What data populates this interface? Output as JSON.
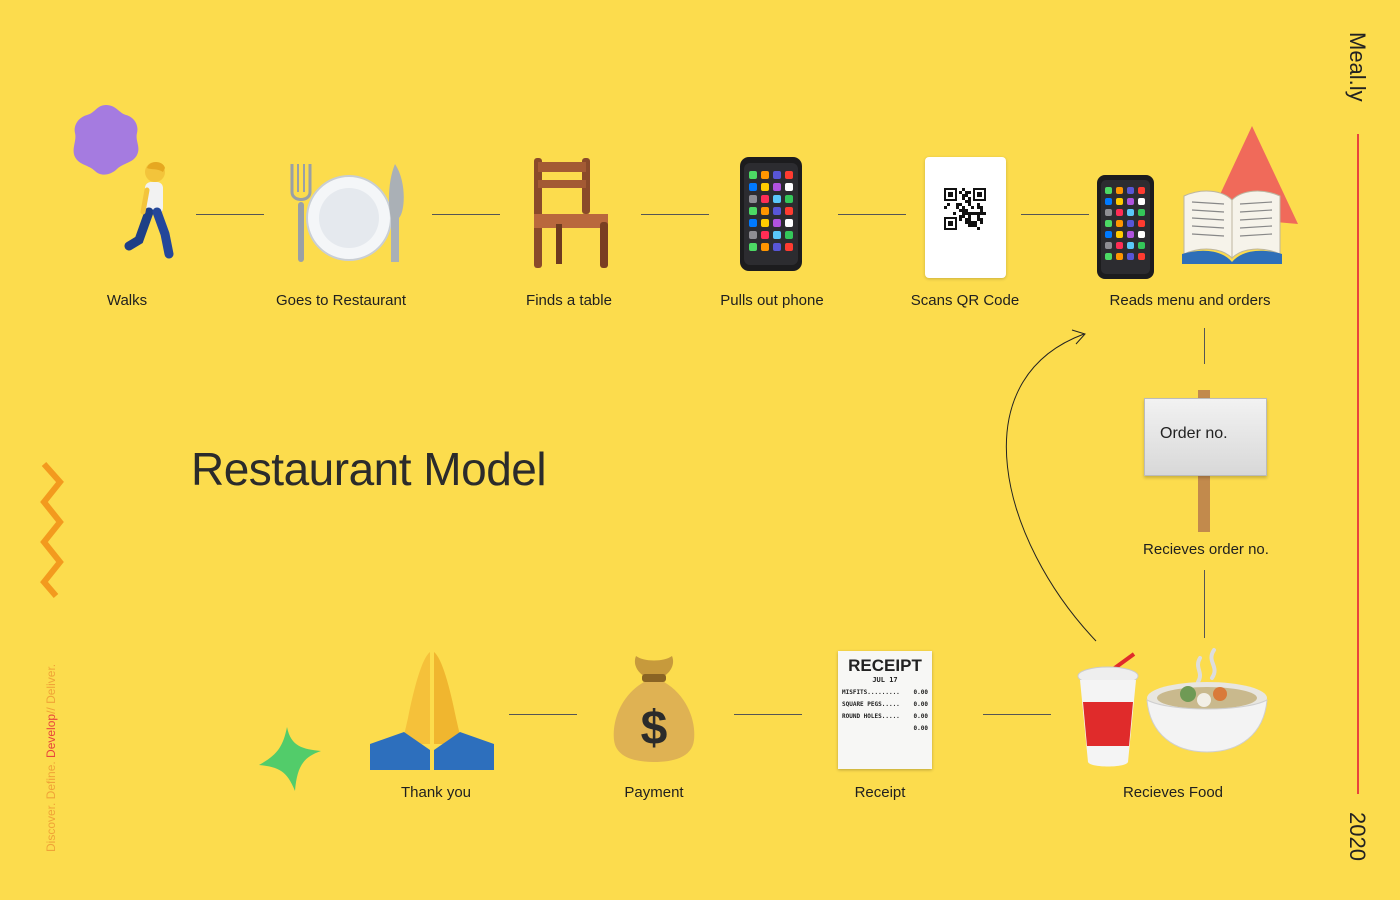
{
  "brand": "Meal.ly",
  "year": "2020",
  "title": "Restaurant Model",
  "phases": {
    "discover": "Discover. ",
    "define": "Define. ",
    "develop": "Develop",
    "separator": "// ",
    "deliver": "Deliver."
  },
  "steps": {
    "walks": "Walks",
    "restaurant": "Goes to Restaurant",
    "table": "Finds a table",
    "phone": "Pulls out phone",
    "qr": "Scans QR Code",
    "menu": "Reads menu and orders",
    "order_no": "Recieves order no.",
    "food": "Recieves Food",
    "receipt": "Receipt",
    "payment": "Payment",
    "thanks": "Thank you"
  },
  "sign": {
    "text": "Order no."
  },
  "receipt_card": {
    "title": "RECEIPT",
    "date": "JUL 17",
    "rows": [
      {
        "item": "MISFITS.........",
        "amount": "0.00"
      },
      {
        "item": "SQUARE PEGS.....",
        "amount": "0.00"
      },
      {
        "item": "ROUND HOLES.....",
        "amount": "0.00"
      },
      {
        "item": "",
        "amount": "0.00"
      }
    ]
  },
  "colors": {
    "background": "#FCDC4D",
    "accent_red": "#E8453C",
    "accent_orange": "#F0A437",
    "purple_shape": "#A57BE0",
    "green_shape": "#52CC6A"
  },
  "icons": [
    "walking-person-icon",
    "plate-cutlery-icon",
    "chair-icon",
    "phone-icon",
    "qr-code-icon",
    "open-book-icon",
    "sign-icon",
    "drink-icon",
    "soup-bowl-icon",
    "receipt-icon",
    "money-bag-icon",
    "praying-hands-icon"
  ]
}
